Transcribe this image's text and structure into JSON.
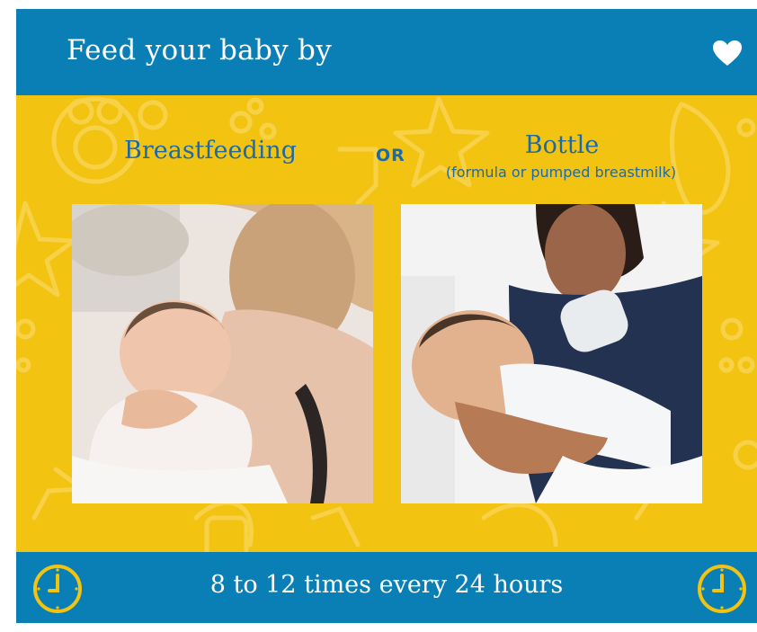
{
  "header": {
    "title": "Feed your baby by",
    "icon": "heart-icon"
  },
  "options": {
    "breastfeeding": "Breastfeeding",
    "or": "OR",
    "bottle": "Bottle",
    "bottle_note": "(formula or pumped breastmilk)"
  },
  "photos": {
    "left_icon": "breastfeeding-photo",
    "right_icon": "bottle-feeding-photo"
  },
  "footer": {
    "text": "8 to 12 times every 24 hours",
    "icon": "clock-icon"
  },
  "colors": {
    "header_bg": "#0a7fb5",
    "panel_bg": "#f3c312",
    "heading_text": "#1d6aa8",
    "clock_stroke": "#f3c312"
  }
}
